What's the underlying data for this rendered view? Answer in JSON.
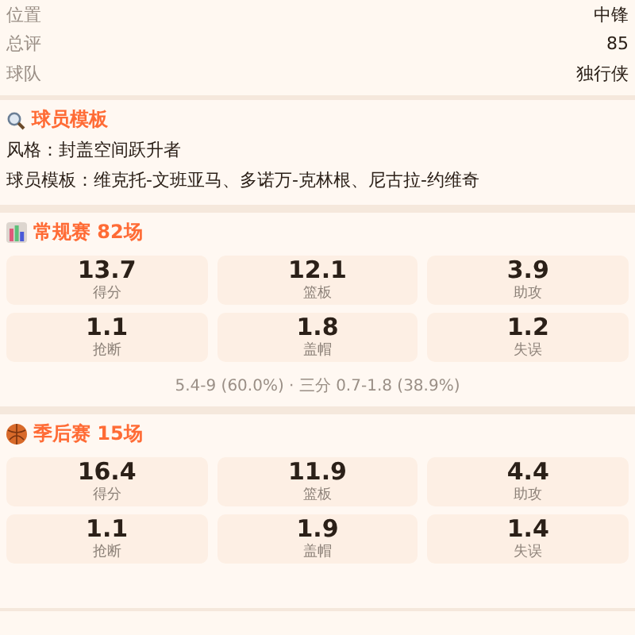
{
  "info_rows": [
    {
      "label": "位置",
      "value": "中锋"
    },
    {
      "label": "总评",
      "value": "85"
    },
    {
      "label": "球队",
      "value": "独行侠"
    }
  ],
  "template": {
    "title": "球员模板",
    "lines": [
      "风格：封盖空间跃升者",
      "球员模板：维克托-文班亚马、多诺万-克林根、尼古拉-约维奇"
    ]
  },
  "sections": [
    {
      "kind": "regular",
      "title": "常规赛 82场",
      "stats": [
        {
          "value": "13.7",
          "label": "得分"
        },
        {
          "value": "12.1",
          "label": "篮板"
        },
        {
          "value": "3.9",
          "label": "助攻"
        },
        {
          "value": "1.1",
          "label": "抢断"
        },
        {
          "value": "1.8",
          "label": "盖帽"
        },
        {
          "value": "1.2",
          "label": "失误"
        }
      ],
      "footer": "5.4-9 (60.0%) · 三分 0.7-1.8 (38.9%)"
    },
    {
      "kind": "playoff",
      "title": "季后赛 15场",
      "stats": [
        {
          "value": "16.4",
          "label": "得分"
        },
        {
          "value": "11.9",
          "label": "篮板"
        },
        {
          "value": "4.4",
          "label": "助攻"
        },
        {
          "value": "1.1",
          "label": "抢断"
        },
        {
          "value": "1.9",
          "label": "盖帽"
        },
        {
          "value": "1.4",
          "label": "失误"
        }
      ]
    }
  ]
}
